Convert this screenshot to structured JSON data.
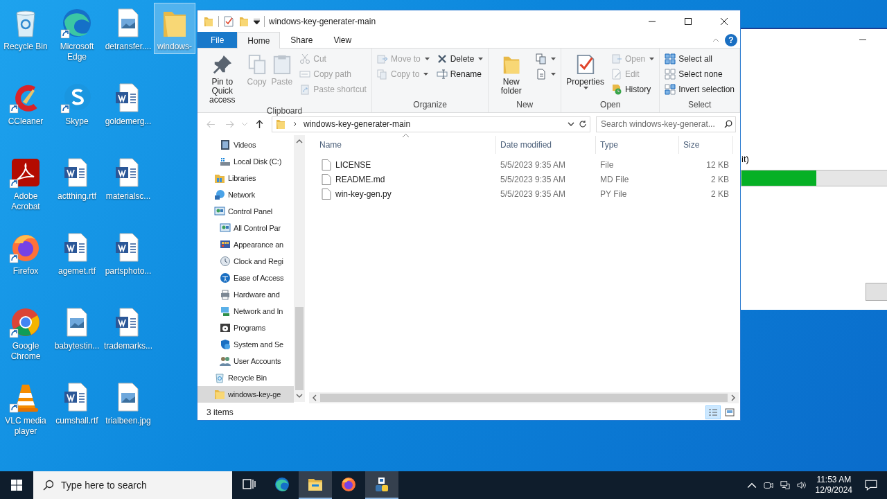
{
  "desktop": {
    "icons": [
      {
        "label": "Recycle Bin",
        "kind": "recycle-bin",
        "shortcut": false,
        "selected": false
      },
      {
        "label": "CCleaner",
        "kind": "ccleaner",
        "shortcut": true,
        "selected": false
      },
      {
        "label": "Adobe Acrobat",
        "kind": "acrobat",
        "shortcut": true,
        "selected": false
      },
      {
        "label": "Firefox",
        "kind": "firefox",
        "shortcut": true,
        "selected": false
      },
      {
        "label": "Google Chrome",
        "kind": "chrome",
        "shortcut": true,
        "selected": false
      },
      {
        "label": "VLC media player",
        "kind": "vlc",
        "shortcut": true,
        "selected": false
      },
      {
        "label": "Microsoft Edge",
        "kind": "edge",
        "shortcut": true,
        "selected": false
      },
      {
        "label": "Skype",
        "kind": "skype",
        "shortcut": true,
        "selected": false
      },
      {
        "label": "actthing.rtf",
        "kind": "word-file",
        "shortcut": false,
        "selected": false
      },
      {
        "label": "agemet.rtf",
        "kind": "word-file",
        "shortcut": false,
        "selected": false
      },
      {
        "label": "babytestin...",
        "kind": "image-file",
        "shortcut": false,
        "selected": false
      },
      {
        "label": "cumshall.rtf",
        "kind": "word-file",
        "shortcut": false,
        "selected": false
      },
      {
        "label": "detransfer....",
        "kind": "image-file",
        "shortcut": false,
        "selected": false
      },
      {
        "label": "goldemerg...",
        "kind": "word-file",
        "shortcut": false,
        "selected": false
      },
      {
        "label": "materialsc...",
        "kind": "word-file",
        "shortcut": false,
        "selected": false
      },
      {
        "label": "partsphoto...",
        "kind": "word-file",
        "shortcut": false,
        "selected": false
      },
      {
        "label": "trademarks...",
        "kind": "word-file",
        "shortcut": false,
        "selected": false
      },
      {
        "label": "trialbeen.jpg",
        "kind": "image-file",
        "shortcut": false,
        "selected": false
      },
      {
        "label": "windows-",
        "kind": "folder",
        "shortcut": false,
        "selected": true
      }
    ]
  },
  "dialog": {
    "text": "it)",
    "progress": {
      "level": 0.51
    }
  },
  "explorer": {
    "title": "windows-key-generater-main",
    "ribbon": {
      "tabs": [
        {
          "label": "File",
          "kind": "menu",
          "selected": false
        },
        {
          "label": "Home",
          "kind": "tab",
          "selected": true
        },
        {
          "label": "Share",
          "kind": "tab",
          "selected": false
        },
        {
          "label": "View",
          "kind": "tab",
          "selected": false
        }
      ],
      "help": "?",
      "groups": [
        {
          "label": "Clipboard",
          "columns": [
            {
              "kind": "large",
              "items": [
                {
                  "label": "Pin to Quick access",
                  "kind": "pin",
                  "disabled": false,
                  "dropdown": false
                },
                {
                  "label": "Copy",
                  "kind": "copy",
                  "disabled": true,
                  "dropdown": false
                },
                {
                  "label": "Paste",
                  "kind": "paste",
                  "disabled": true,
                  "dropdown": false
                }
              ]
            },
            {
              "kind": "stack",
              "items": [
                {
                  "label": "Cut",
                  "kind": "cut",
                  "disabled": true,
                  "dropdown": false
                },
                {
                  "label": "Copy path",
                  "kind": "copy-path",
                  "disabled": true,
                  "dropdown": false
                },
                {
                  "label": "Paste shortcut",
                  "kind": "paste-shortcut",
                  "disabled": true,
                  "dropdown": false
                }
              ]
            }
          ]
        },
        {
          "label": "Organize",
          "columns": [
            {
              "kind": "stack",
              "items": [
                {
                  "label": "Move to",
                  "kind": "move-to",
                  "disabled": true,
                  "dropdown": true
                },
                {
                  "label": "Copy to",
                  "kind": "copy-to",
                  "disabled": true,
                  "dropdown": true
                }
              ]
            },
            {
              "kind": "stack",
              "items": [
                {
                  "label": "Delete",
                  "kind": "delete",
                  "disabled": false,
                  "dropdown": true
                },
                {
                  "label": "Rename",
                  "kind": "rename",
                  "disabled": false,
                  "dropdown": false
                }
              ]
            }
          ]
        },
        {
          "label": "New",
          "columns": [
            {
              "kind": "large",
              "items": [
                {
                  "label": "New folder",
                  "kind": "new-folder",
                  "disabled": false,
                  "dropdown": false
                }
              ]
            },
            {
              "kind": "stack",
              "items": [
                {
                  "kind": "new-item",
                  "disabled": false,
                  "dropdown": true
                },
                {
                  "kind": "easy-access",
                  "disabled": false,
                  "dropdown": true
                }
              ]
            }
          ]
        },
        {
          "label": "Open",
          "columns": [
            {
              "kind": "large",
              "items": [
                {
                  "label": "Properties",
                  "kind": "properties",
                  "disabled": false,
                  "dropdown": true
                }
              ]
            },
            {
              "kind": "stack",
              "items": [
                {
                  "label": "Open",
                  "kind": "open",
                  "disabled": true,
                  "dropdown": true
                },
                {
                  "label": "Edit",
                  "kind": "edit",
                  "disabled": true,
                  "dropdown": false
                },
                {
                  "label": "History",
                  "kind": "history",
                  "disabled": false,
                  "dropdown": false
                }
              ]
            }
          ]
        },
        {
          "label": "Select",
          "columns": [
            {
              "kind": "stack",
              "items": [
                {
                  "label": "Select all",
                  "kind": "select-all",
                  "disabled": false,
                  "dropdown": false
                },
                {
                  "label": "Select none",
                  "kind": "select-none",
                  "disabled": false,
                  "dropdown": false
                },
                {
                  "label": "Invert selection",
                  "kind": "invert",
                  "disabled": false,
                  "dropdown": false
                }
              ]
            }
          ]
        }
      ]
    },
    "address": {
      "path": "windows-key-generater-main"
    },
    "search": {
      "placeholder": "Search windows-key-generat..."
    },
    "navigation": {
      "scrolled_group": {
        "children": [
          {
            "label": "Videos",
            "kind": "videos",
            "selected": false
          },
          {
            "label": "Local Disk (C:)",
            "kind": "disk",
            "selected": false
          }
        ]
      },
      "items": [
        {
          "label": "Libraries",
          "kind": "libraries",
          "selected": false
        },
        {
          "label": "Network",
          "kind": "network",
          "selected": false
        },
        {
          "label": "Control Panel",
          "kind": "control-panel",
          "selected": false,
          "children": [
            {
              "label": "All Control Par",
              "kind": "control-panel",
              "selected": false
            },
            {
              "label": "Appearance an",
              "kind": "appearance",
              "selected": false
            },
            {
              "label": "Clock and Regi",
              "kind": "clock",
              "selected": false
            },
            {
              "label": "Ease of Access",
              "kind": "ease",
              "selected": false
            },
            {
              "label": "Hardware and",
              "kind": "hardware",
              "selected": false
            },
            {
              "label": "Network and In",
              "kind": "network-cp",
              "selected": false
            },
            {
              "label": "Programs",
              "kind": "programs",
              "selected": false
            },
            {
              "label": "System and Se",
              "kind": "system",
              "selected": false
            },
            {
              "label": "User Accounts",
              "kind": "users",
              "selected": false
            }
          ]
        },
        {
          "label": "Recycle Bin",
          "kind": "recycle-bin",
          "selected": false
        },
        {
          "label": "windows-key-ge",
          "kind": "folder",
          "selected": true
        }
      ]
    },
    "columns": [
      {
        "label": "Name",
        "sorted": true
      },
      {
        "label": "Date modified",
        "sorted": false
      },
      {
        "label": "Type",
        "sorted": false
      },
      {
        "label": "Size",
        "sorted": false
      }
    ],
    "files": [
      {
        "name": "LICENSE",
        "date": "5/5/2023 9:35 AM",
        "type": "File",
        "size": "12 KB"
      },
      {
        "name": "README.md",
        "date": "5/5/2023 9:35 AM",
        "type": "MD File",
        "size": "2 KB"
      },
      {
        "name": "win-key-gen.py",
        "date": "5/5/2023 9:35 AM",
        "type": "PY File",
        "size": "2 KB"
      }
    ],
    "status": {
      "count": "3 items",
      "views": [
        {
          "kind": "details",
          "selected": true
        },
        {
          "kind": "large-icons",
          "selected": false
        }
      ]
    }
  },
  "taskbar": {
    "search": {
      "placeholder": "Type here to search"
    },
    "apps": [
      {
        "kind": "task-view",
        "active": false
      },
      {
        "kind": "edge",
        "active": false
      },
      {
        "kind": "file-explorer",
        "active": true
      },
      {
        "kind": "firefox",
        "active": false
      },
      {
        "kind": "python-app",
        "active": true
      }
    ],
    "clock": {
      "time": "11:53 AM",
      "date": "12/9/2024"
    }
  }
}
